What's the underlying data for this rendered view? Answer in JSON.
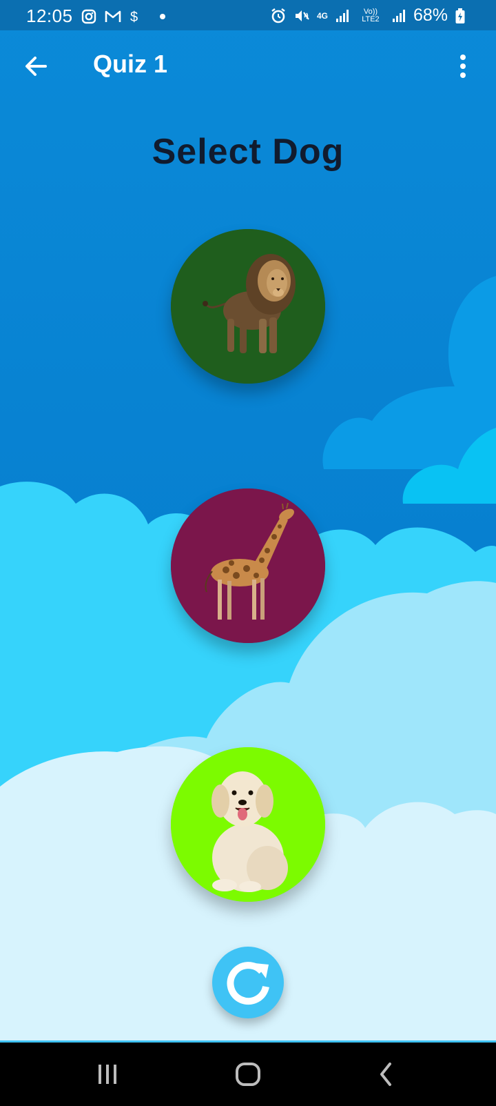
{
  "status_bar": {
    "time": "12:05",
    "battery": "68%",
    "left_icons": [
      "instagram-icon",
      "gmail-icon",
      "dollar-icon",
      "dot-icon"
    ],
    "right_icons": [
      "alarm-icon",
      "mute-icon",
      "4g-icon",
      "signal-icon",
      "volte-icon",
      "signal-icon",
      "battery-icon"
    ],
    "network_label": "4G",
    "volte_label": "Vo)) LTE2"
  },
  "app_bar": {
    "title": "Quiz 1",
    "back_icon": "arrow-left-icon",
    "menu_icon": "more-vertical-icon"
  },
  "quiz": {
    "prompt": "Select Dog",
    "options": [
      {
        "animal": "lion",
        "bg_color": "#1f5e1d"
      },
      {
        "animal": "giraffe",
        "bg_color": "#7b164b"
      },
      {
        "animal": "dog",
        "bg_color": "#7cfb00"
      }
    ],
    "reload_icon": "refresh-icon"
  },
  "nav_bar": {
    "icons": [
      "recent-apps-icon",
      "home-icon",
      "back-icon"
    ]
  },
  "colors": {
    "sky": "#0a86d6",
    "status_bar": "#0b6fb1",
    "accent": "#3fc3f5"
  }
}
